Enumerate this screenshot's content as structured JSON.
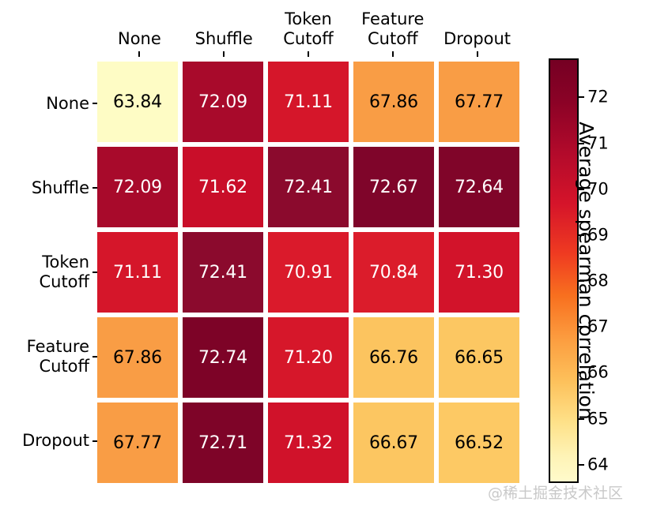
{
  "chart_data": {
    "type": "heatmap",
    "title": "",
    "xlabel": "",
    "ylabel": "",
    "colorbar_label": "Average spearman correlation",
    "colormap": "YlOrRd",
    "grid": false,
    "legend_position": "right-colorbar",
    "categories_x": [
      "None",
      "Shuffle",
      "Token\nCutoff",
      "Feature\nCutoff",
      "Dropout"
    ],
    "categories_y": [
      "None",
      "Shuffle",
      "Token\nCutoff",
      "Feature\nCutoff",
      "Dropout"
    ],
    "values": [
      [
        63.84,
        72.09,
        71.11,
        67.86,
        67.77
      ],
      [
        72.09,
        71.62,
        72.41,
        72.67,
        72.64
      ],
      [
        71.11,
        72.41,
        70.91,
        70.84,
        71.3
      ],
      [
        67.86,
        72.74,
        71.2,
        66.76,
        66.65
      ],
      [
        67.77,
        72.71,
        71.32,
        66.67,
        66.52
      ]
    ],
    "cell_colors": [
      [
        "#fefcc5",
        "#a80a2b",
        "#d5162a",
        "#f99d45",
        "#f99d45"
      ],
      [
        "#a80a2b",
        "#c90e29",
        "#8b0a2d",
        "#7f052a",
        "#800529"
      ],
      [
        "#d5162a",
        "#8b0a2d",
        "#da1a2b",
        "#db1c2b",
        "#d2132a"
      ],
      [
        "#f99d45",
        "#7d0327",
        "#d6172a",
        "#fcc45f",
        "#fcc762"
      ],
      [
        "#f99d45",
        "#7e0428",
        "#d0122a",
        "#fcc661",
        "#fdc964"
      ]
    ],
    "cell_text_colors": [
      [
        "#000000",
        "#ffffff",
        "#ffffff",
        "#000000",
        "#000000"
      ],
      [
        "#ffffff",
        "#ffffff",
        "#ffffff",
        "#ffffff",
        "#ffffff"
      ],
      [
        "#ffffff",
        "#ffffff",
        "#ffffff",
        "#ffffff",
        "#ffffff"
      ],
      [
        "#000000",
        "#ffffff",
        "#ffffff",
        "#000000",
        "#000000"
      ],
      [
        "#000000",
        "#ffffff",
        "#ffffff",
        "#000000",
        "#000000"
      ]
    ],
    "colorbar": {
      "vmin": 63.6,
      "vmax": 72.85,
      "ticks": [
        72,
        71,
        70,
        69,
        68,
        67,
        66,
        65,
        64
      ],
      "tick_labels": [
        "72",
        "71",
        "70",
        "69",
        "68",
        "67",
        "66",
        "65",
        "64"
      ],
      "gradient_stops": [
        {
          "pos": 0,
          "color": "#750023"
        },
        {
          "pos": 10,
          "color": "#8b0226"
        },
        {
          "pos": 22,
          "color": "#b20a2b"
        },
        {
          "pos": 34,
          "color": "#d5142a"
        },
        {
          "pos": 46,
          "color": "#ef3b21"
        },
        {
          "pos": 56,
          "color": "#f8701f"
        },
        {
          "pos": 66,
          "color": "#fc9c3f"
        },
        {
          "pos": 76,
          "color": "#fdc05a"
        },
        {
          "pos": 86,
          "color": "#fee189"
        },
        {
          "pos": 94,
          "color": "#fef3b6"
        },
        {
          "pos": 100,
          "color": "#fffbcb"
        }
      ]
    }
  },
  "watermark": {
    "text": "@稀土掘金技术社区"
  }
}
